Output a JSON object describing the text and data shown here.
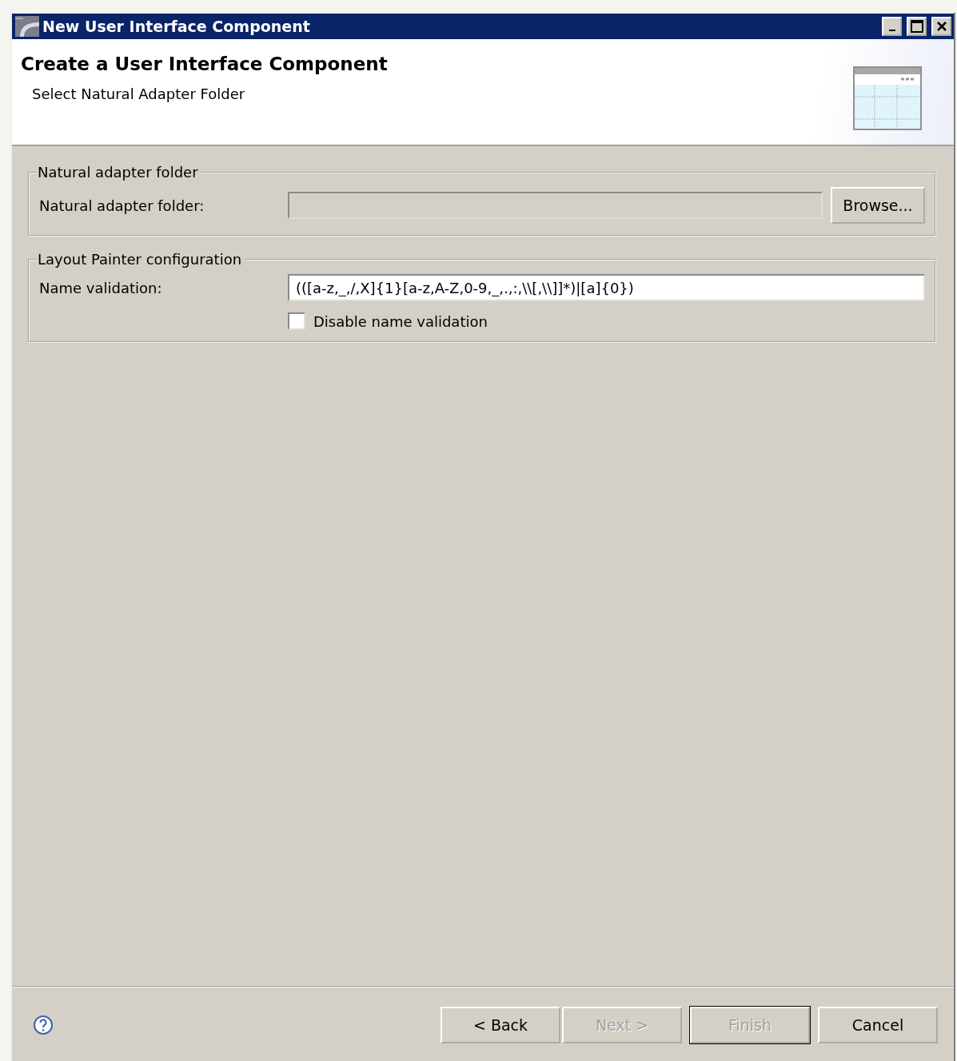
{
  "window": {
    "title": "New User Interface Component"
  },
  "header": {
    "title": "Create a User Interface Component",
    "subtitle": "Select Natural Adapter Folder"
  },
  "groups": [
    {
      "title": "Natural adapter folder",
      "rows": [
        {
          "kind": "browse",
          "label": "Natural adapter folder:",
          "disabled": true,
          "button": "Browse..."
        }
      ]
    },
    {
      "title": "Layout Painter configuration",
      "rows": [
        {
          "kind": "text",
          "label": "Name validation:",
          "value": "(([a-z,_,/,X]{1}[a-z,A-Z,0-9,_,.,:,\\\\[,\\\\]]*)|[a]{0})"
        },
        {
          "kind": "checkbox",
          "label": "Disable name validation",
          "checked": false
        }
      ]
    }
  ],
  "buttons": [
    {
      "label": "< Back",
      "disabled": false,
      "default": false
    },
    {
      "label": "Next >",
      "disabled": true,
      "default": false
    },
    {
      "label": "Finish",
      "disabled": true,
      "default": true
    },
    {
      "label": "Cancel",
      "disabled": false,
      "default": false
    }
  ]
}
